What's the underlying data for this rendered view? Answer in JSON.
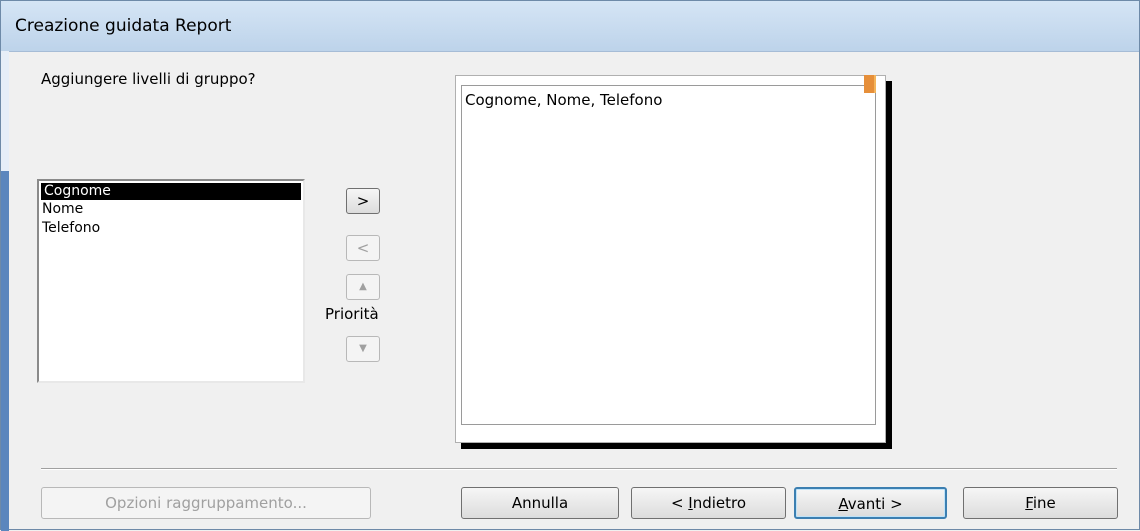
{
  "window": {
    "title": "Creazione guidata Report"
  },
  "wizard": {
    "question": "Aggiungere livelli di gruppo?",
    "fields": [
      {
        "label": "Cognome",
        "selected": true
      },
      {
        "label": "Nome",
        "selected": false
      },
      {
        "label": "Telefono",
        "selected": false
      }
    ],
    "move_buttons": {
      "add": ">",
      "remove": "<",
      "up": "▲",
      "down": "▼"
    },
    "priority_label": "Priorità",
    "preview_text": "Cognome, Nome, Telefono"
  },
  "footer": {
    "grouping_options": "Opzioni raggruppamento...",
    "cancel": "Annulla",
    "back_prefix": "< ",
    "back_underline": "I",
    "back_rest": "ndietro",
    "next_underline": "A",
    "next_rest": "vanti >",
    "finish_underline": "F",
    "finish_rest": "ine"
  }
}
